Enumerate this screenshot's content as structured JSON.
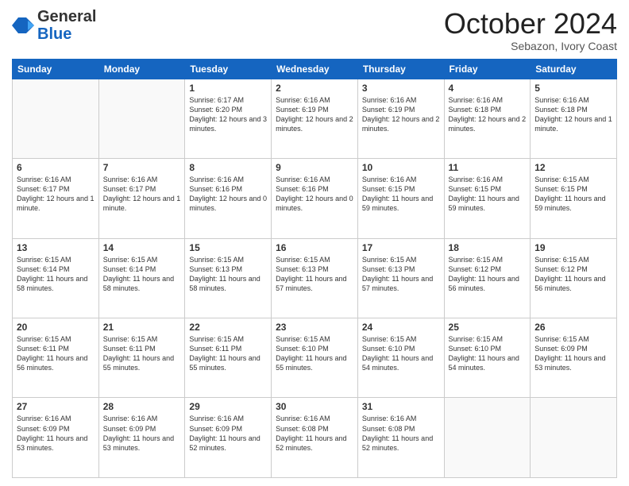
{
  "header": {
    "logo_line1": "General",
    "logo_line2": "Blue",
    "month": "October 2024",
    "location": "Sebazon, Ivory Coast"
  },
  "days_of_week": [
    "Sunday",
    "Monday",
    "Tuesday",
    "Wednesday",
    "Thursday",
    "Friday",
    "Saturday"
  ],
  "weeks": [
    [
      {
        "day": "",
        "text": ""
      },
      {
        "day": "",
        "text": ""
      },
      {
        "day": "1",
        "text": "Sunrise: 6:17 AM\nSunset: 6:20 PM\nDaylight: 12 hours and 3 minutes."
      },
      {
        "day": "2",
        "text": "Sunrise: 6:16 AM\nSunset: 6:19 PM\nDaylight: 12 hours and 2 minutes."
      },
      {
        "day": "3",
        "text": "Sunrise: 6:16 AM\nSunset: 6:19 PM\nDaylight: 12 hours and 2 minutes."
      },
      {
        "day": "4",
        "text": "Sunrise: 6:16 AM\nSunset: 6:18 PM\nDaylight: 12 hours and 2 minutes."
      },
      {
        "day": "5",
        "text": "Sunrise: 6:16 AM\nSunset: 6:18 PM\nDaylight: 12 hours and 1 minute."
      }
    ],
    [
      {
        "day": "6",
        "text": "Sunrise: 6:16 AM\nSunset: 6:17 PM\nDaylight: 12 hours and 1 minute."
      },
      {
        "day": "7",
        "text": "Sunrise: 6:16 AM\nSunset: 6:17 PM\nDaylight: 12 hours and 1 minute."
      },
      {
        "day": "8",
        "text": "Sunrise: 6:16 AM\nSunset: 6:16 PM\nDaylight: 12 hours and 0 minutes."
      },
      {
        "day": "9",
        "text": "Sunrise: 6:16 AM\nSunset: 6:16 PM\nDaylight: 12 hours and 0 minutes."
      },
      {
        "day": "10",
        "text": "Sunrise: 6:16 AM\nSunset: 6:15 PM\nDaylight: 11 hours and 59 minutes."
      },
      {
        "day": "11",
        "text": "Sunrise: 6:16 AM\nSunset: 6:15 PM\nDaylight: 11 hours and 59 minutes."
      },
      {
        "day": "12",
        "text": "Sunrise: 6:15 AM\nSunset: 6:15 PM\nDaylight: 11 hours and 59 minutes."
      }
    ],
    [
      {
        "day": "13",
        "text": "Sunrise: 6:15 AM\nSunset: 6:14 PM\nDaylight: 11 hours and 58 minutes."
      },
      {
        "day": "14",
        "text": "Sunrise: 6:15 AM\nSunset: 6:14 PM\nDaylight: 11 hours and 58 minutes."
      },
      {
        "day": "15",
        "text": "Sunrise: 6:15 AM\nSunset: 6:13 PM\nDaylight: 11 hours and 58 minutes."
      },
      {
        "day": "16",
        "text": "Sunrise: 6:15 AM\nSunset: 6:13 PM\nDaylight: 11 hours and 57 minutes."
      },
      {
        "day": "17",
        "text": "Sunrise: 6:15 AM\nSunset: 6:13 PM\nDaylight: 11 hours and 57 minutes."
      },
      {
        "day": "18",
        "text": "Sunrise: 6:15 AM\nSunset: 6:12 PM\nDaylight: 11 hours and 56 minutes."
      },
      {
        "day": "19",
        "text": "Sunrise: 6:15 AM\nSunset: 6:12 PM\nDaylight: 11 hours and 56 minutes."
      }
    ],
    [
      {
        "day": "20",
        "text": "Sunrise: 6:15 AM\nSunset: 6:11 PM\nDaylight: 11 hours and 56 minutes."
      },
      {
        "day": "21",
        "text": "Sunrise: 6:15 AM\nSunset: 6:11 PM\nDaylight: 11 hours and 55 minutes."
      },
      {
        "day": "22",
        "text": "Sunrise: 6:15 AM\nSunset: 6:11 PM\nDaylight: 11 hours and 55 minutes."
      },
      {
        "day": "23",
        "text": "Sunrise: 6:15 AM\nSunset: 6:10 PM\nDaylight: 11 hours and 55 minutes."
      },
      {
        "day": "24",
        "text": "Sunrise: 6:15 AM\nSunset: 6:10 PM\nDaylight: 11 hours and 54 minutes."
      },
      {
        "day": "25",
        "text": "Sunrise: 6:15 AM\nSunset: 6:10 PM\nDaylight: 11 hours and 54 minutes."
      },
      {
        "day": "26",
        "text": "Sunrise: 6:15 AM\nSunset: 6:09 PM\nDaylight: 11 hours and 53 minutes."
      }
    ],
    [
      {
        "day": "27",
        "text": "Sunrise: 6:16 AM\nSunset: 6:09 PM\nDaylight: 11 hours and 53 minutes."
      },
      {
        "day": "28",
        "text": "Sunrise: 6:16 AM\nSunset: 6:09 PM\nDaylight: 11 hours and 53 minutes."
      },
      {
        "day": "29",
        "text": "Sunrise: 6:16 AM\nSunset: 6:09 PM\nDaylight: 11 hours and 52 minutes."
      },
      {
        "day": "30",
        "text": "Sunrise: 6:16 AM\nSunset: 6:08 PM\nDaylight: 11 hours and 52 minutes."
      },
      {
        "day": "31",
        "text": "Sunrise: 6:16 AM\nSunset: 6:08 PM\nDaylight: 11 hours and 52 minutes."
      },
      {
        "day": "",
        "text": ""
      },
      {
        "day": "",
        "text": ""
      }
    ]
  ]
}
